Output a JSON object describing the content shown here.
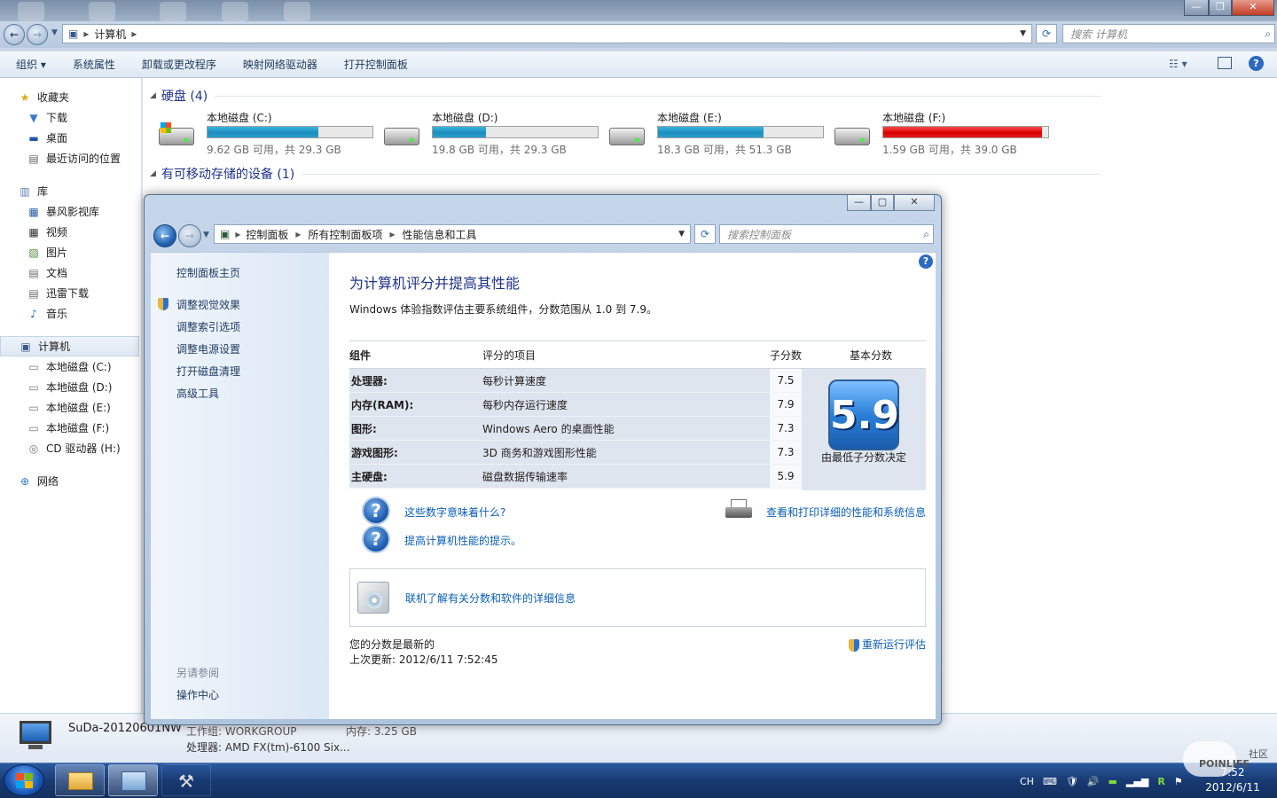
{
  "explorer": {
    "address": "计算机",
    "search_placeholder": "搜索 计算机",
    "window_buttons": {
      "minimize": "—",
      "maximize": "❐",
      "close": "✕"
    },
    "toolbar": [
      "组织 ▾",
      "系统属性",
      "卸载或更改程序",
      "映射网络驱动器",
      "打开控制面板"
    ],
    "nav": {
      "favorites": {
        "label": "收藏夹",
        "items": [
          "下载",
          "桌面",
          "最近访问的位置"
        ]
      },
      "libraries": {
        "label": "库",
        "items": [
          "暴风影视库",
          "视频",
          "图片",
          "文档",
          "迅雷下载",
          "音乐"
        ]
      },
      "computer": {
        "label": "计算机",
        "items": [
          "本地磁盘 (C:)",
          "本地磁盘 (D:)",
          "本地磁盘 (E:)",
          "本地磁盘 (F:)",
          "CD 驱动器 (H:)"
        ]
      },
      "network": {
        "label": "网络"
      }
    },
    "hdd_group": "硬盘 (4)",
    "removable_group": "有可移动存储的设备 (1)",
    "drives": [
      {
        "name": "本地磁盘 (C:)",
        "info": "9.62 GB 可用，共 29.3 GB",
        "used_fraction": 0.67,
        "critical": false
      },
      {
        "name": "本地磁盘 (D:)",
        "info": "19.8 GB 可用，共 29.3 GB",
        "used_fraction": 0.32,
        "critical": false
      },
      {
        "name": "本地磁盘 (E:)",
        "info": "18.3 GB 可用，共 51.3 GB",
        "used_fraction": 0.64,
        "critical": false
      },
      {
        "name": "本地磁盘 (F:)",
        "info": "1.59 GB 可用，共 39.0 GB",
        "used_fraction": 0.96,
        "critical": true
      }
    ],
    "details": {
      "computer_name": "SuDa-20120601NW",
      "workgroup": "工作组: WORKGROUP",
      "memory": "内存: 3.25 GB",
      "processor": "处理器: AMD FX(tm)-6100 Six..."
    }
  },
  "control_panel": {
    "breadcrumb": [
      "控制面板",
      "所有控制面板项",
      "性能信息和工具"
    ],
    "search_placeholder": "搜索控制面板",
    "left_links": {
      "home": "控制面板主页",
      "tasks": [
        "调整视觉效果",
        "调整索引选项",
        "调整电源设置",
        "打开磁盘清理",
        "高级工具"
      ],
      "see_also": "另请参阅",
      "action_center": "操作中心"
    },
    "title": "为计算机评分并提高其性能",
    "subtitle": "Windows 体验指数评估主要系统组件，分数范围从 1.0 到 7.9。",
    "table": {
      "headers": {
        "component": "组件",
        "rated": "评分的项目",
        "subscore": "子分数",
        "base": "基本分数"
      },
      "rows": [
        {
          "component": "处理器:",
          "item": "每秒计算速度",
          "score": "7.5"
        },
        {
          "component": "内存(RAM):",
          "item": "每秒内存运行速度",
          "score": "7.9"
        },
        {
          "component": "图形:",
          "item": "Windows Aero 的桌面性能",
          "score": "7.3"
        },
        {
          "component": "游戏图形:",
          "item": "3D 商务和游戏图形性能",
          "score": "7.3"
        },
        {
          "component": "主硬盘:",
          "item": "磁盘数据传输速率",
          "score": "5.9"
        }
      ],
      "base_score": "5.9",
      "base_caption": "由最低子分数决定"
    },
    "links": {
      "meaning": "这些数字意味着什么?",
      "tips": "提高计算机性能的提示。",
      "print": "查看和打印详细的性能和系统信息",
      "online": "联机了解有关分数和软件的详细信息",
      "rerun": "重新运行评估"
    },
    "status": "您的分数是最新的",
    "last_update": "上次更新: 2012/6/11 7:52:45"
  },
  "taskbar": {
    "tray": [
      "CH",
      "⌨",
      "🛡",
      "🔊",
      "▬",
      "▂▄▆",
      "R",
      "⚑"
    ],
    "time": "7:52",
    "date": "2012/6/11"
  },
  "watermark": {
    "text": "POINLIFE",
    "sub": "社区"
  },
  "colors": {
    "disk_ok": "#1e8dbd",
    "disk_critical": "#d60000",
    "link": "#0b5fb5",
    "group_header": "#1e3287"
  }
}
